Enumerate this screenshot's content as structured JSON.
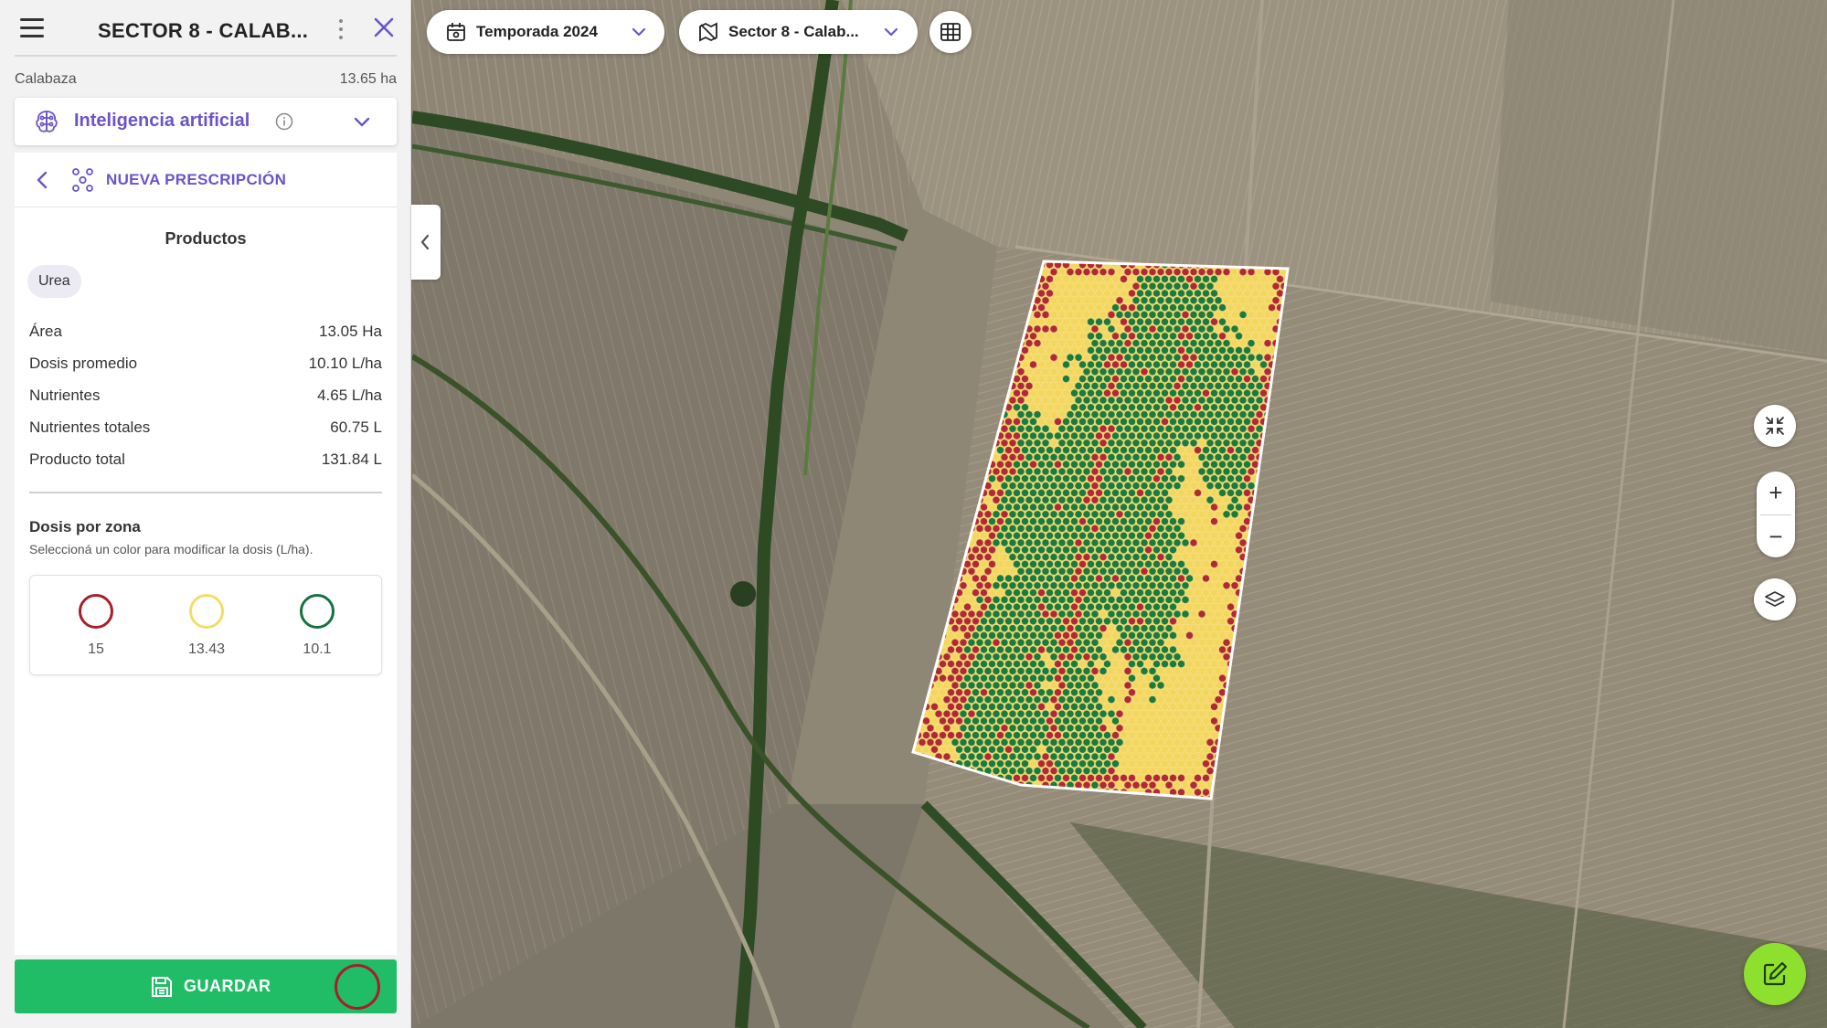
{
  "sidebar": {
    "title": "SECTOR 8 - CALAB...",
    "crop": "Calabaza",
    "crop_area": "13.65 ha",
    "ai_label": "Inteligencia artificial",
    "prescription_label": "NUEVA PRESCRIPCIÓN",
    "products_title": "Productos",
    "product_chip": "Urea",
    "stats": [
      {
        "label": "Área",
        "value": "13.05 Ha"
      },
      {
        "label": "Dosis promedio",
        "value": "10.10 L/ha"
      },
      {
        "label": "Nutrientes",
        "value": "4.65 L/ha"
      },
      {
        "label": "Nutrientes totales",
        "value": "60.75 L"
      },
      {
        "label": "Producto total",
        "value": "131.84 L"
      }
    ],
    "dose_title": "Dosis por zona",
    "dose_subtitle": "Seleccioná un color para modificar la dosis (L/ha).",
    "zones": [
      {
        "color": "#a61f2a",
        "dose": "15"
      },
      {
        "color": "#f2dc6a",
        "dose": "13.43"
      },
      {
        "color": "#15733f",
        "dose": "10.1"
      }
    ],
    "save_label": "GUARDAR"
  },
  "toolbar": {
    "season": "Temporada 2024",
    "field": "Sector 8 - Calab..."
  },
  "colors": {
    "accent": "#6a54c9",
    "save": "#20bd66",
    "edit_fab": "#8ee02e",
    "zone_red": "#b02a35",
    "zone_yellow": "#f3d65c",
    "zone_green": "#1c7a3d"
  },
  "icons": {
    "menu": "hamburger-icon",
    "more": "kebab-icon",
    "close": "close-icon",
    "ai": "brain-icon",
    "info": "info-icon",
    "calendar": "calendar-icon",
    "field": "field-map-icon",
    "table": "table-icon",
    "recenter": "recenter-icon",
    "layers": "layers-icon",
    "edit": "edit-icon",
    "save": "floppy-icon"
  }
}
